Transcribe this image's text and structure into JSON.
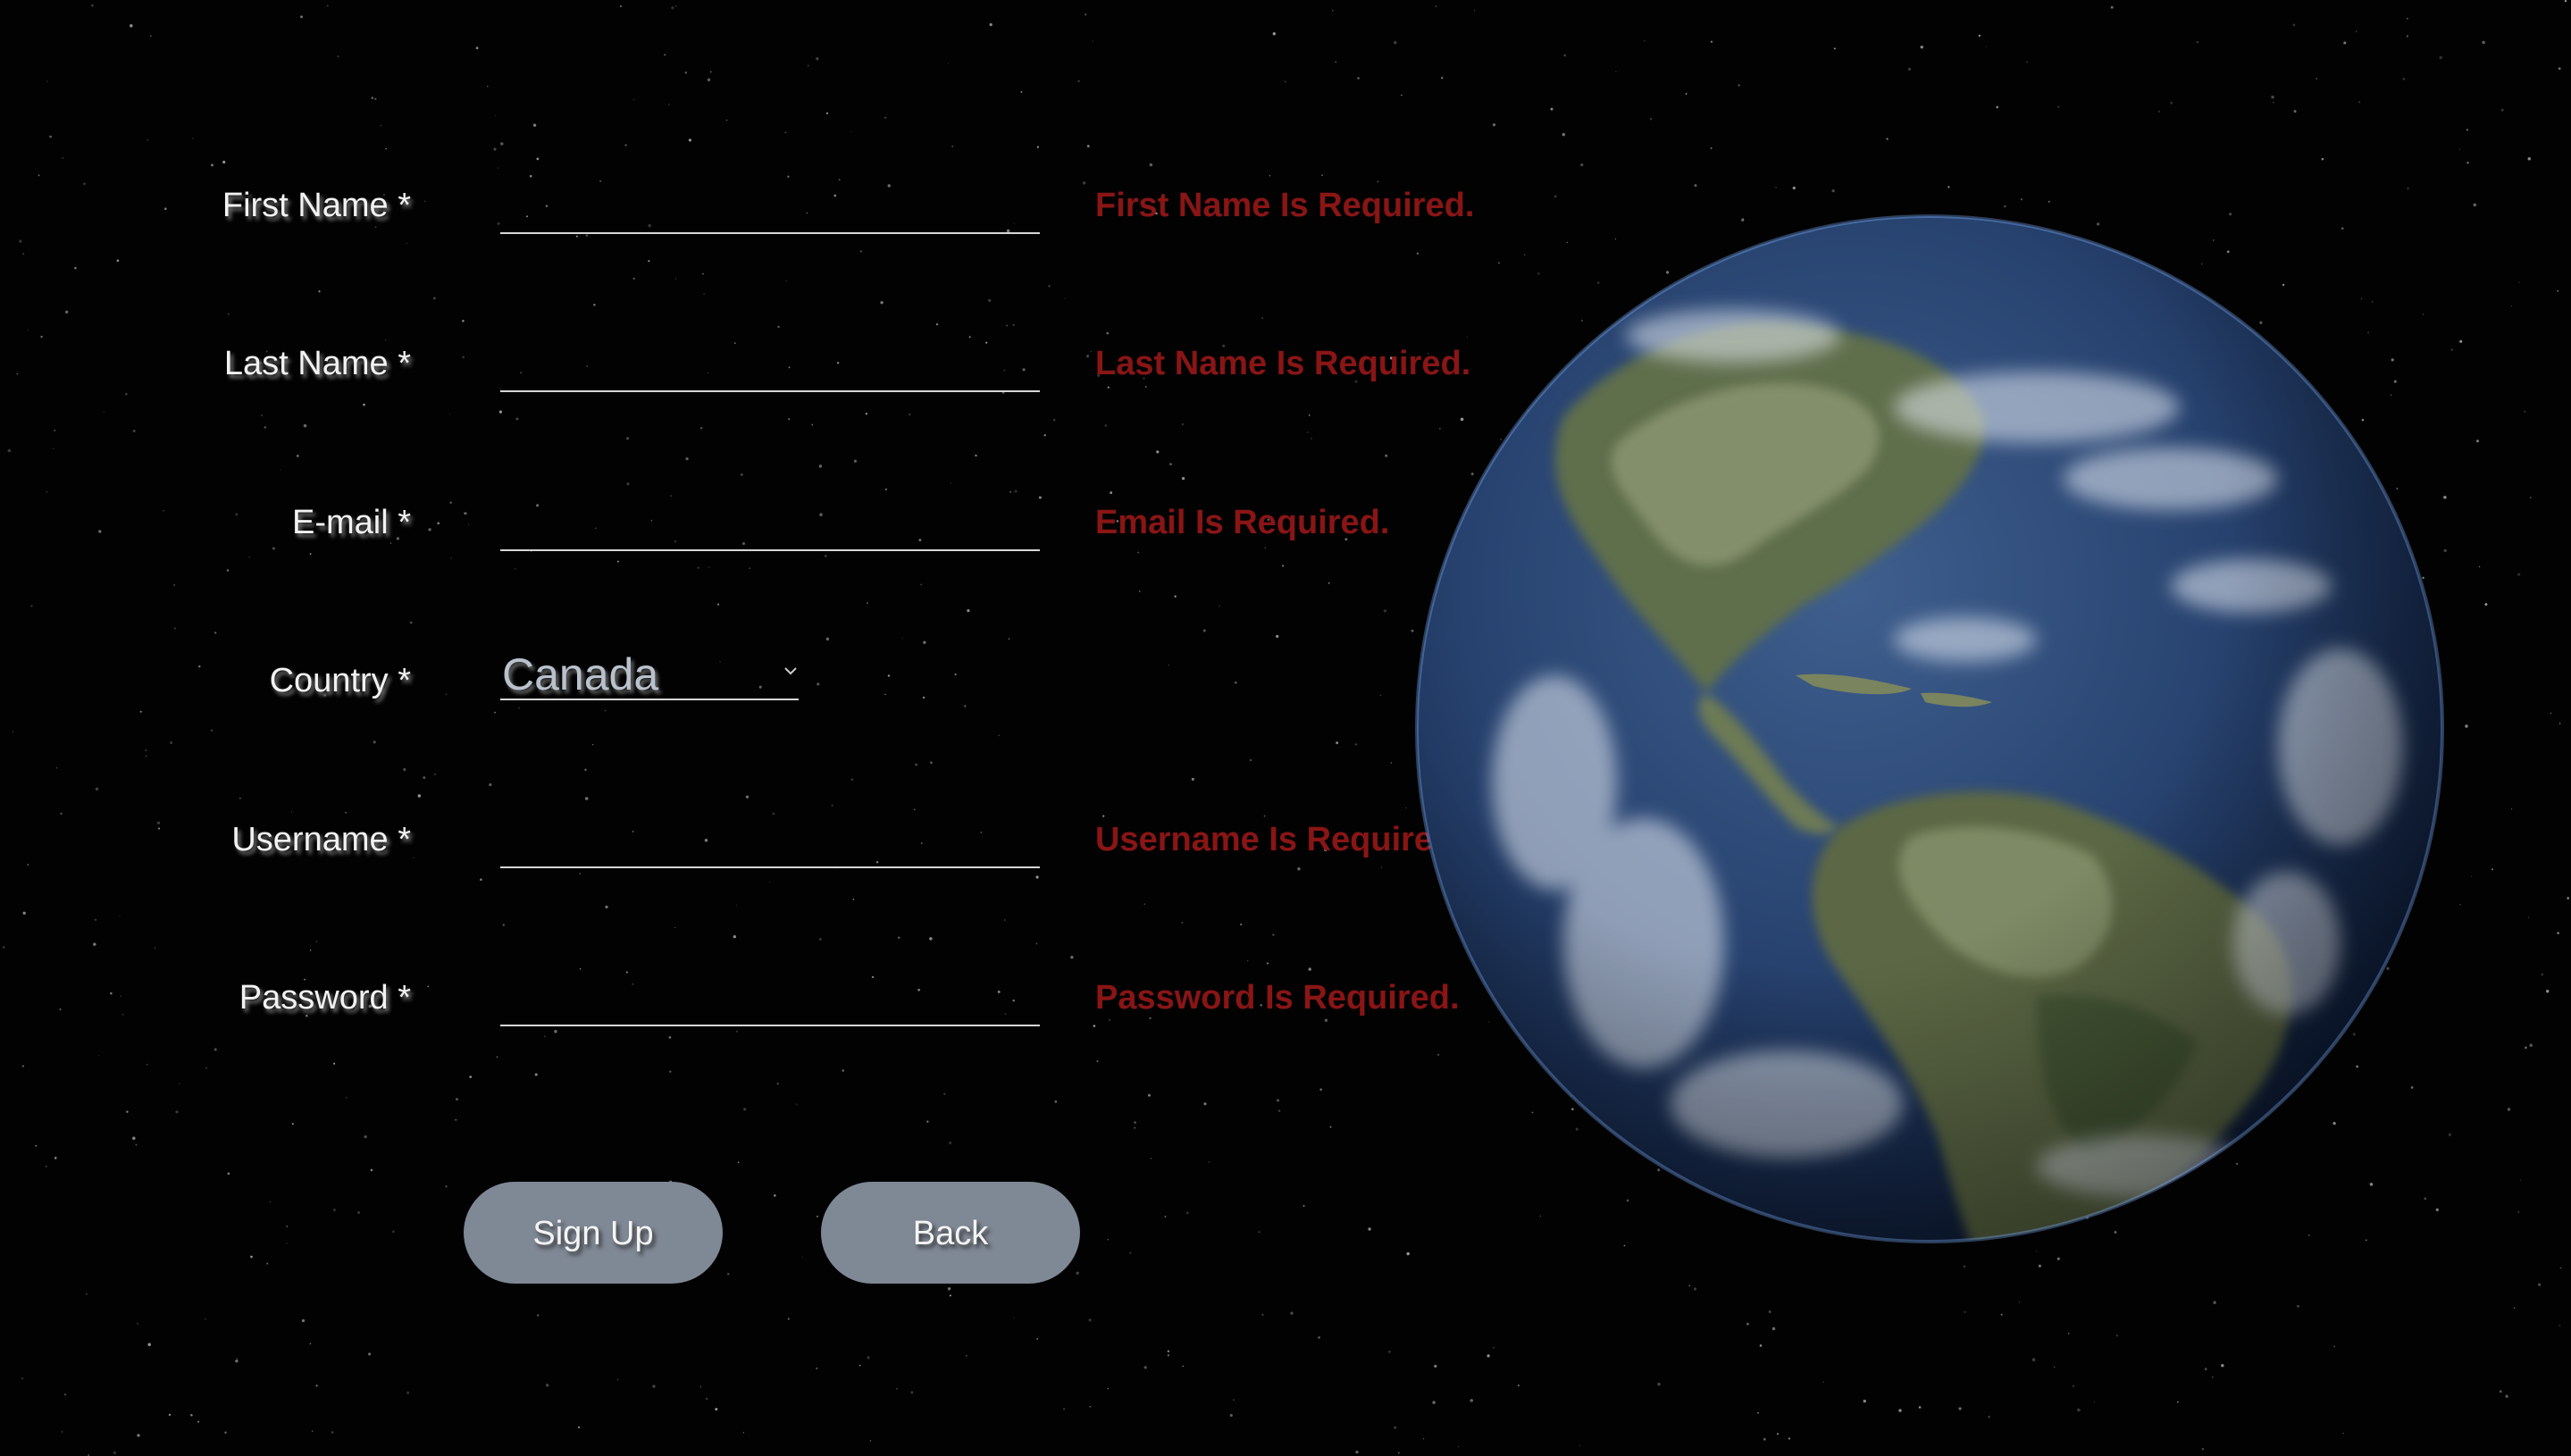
{
  "form": {
    "fields": [
      {
        "key": "first_name",
        "label": "First Name *",
        "value": "",
        "error": "First Name Is Required."
      },
      {
        "key": "last_name",
        "label": "Last Name *",
        "value": "",
        "error": "Last Name Is Required."
      },
      {
        "key": "email",
        "label": "E-mail *",
        "value": "",
        "error": "Email Is Required."
      },
      {
        "key": "country",
        "label": "Country *",
        "value": "Canada",
        "error": ""
      },
      {
        "key": "username",
        "label": "Username *",
        "value": "",
        "error": "Username Is Required."
      },
      {
        "key": "password",
        "label": "Password *",
        "value": "",
        "error": "Password Is Required."
      }
    ],
    "buttons": {
      "signup_label": "Sign Up",
      "back_label": "Back"
    }
  },
  "colors": {
    "background": "#020203",
    "error": "#8a1515",
    "button": "#7f8895",
    "label": "#f2f2f2"
  },
  "icons": {
    "select": "chevron-down-icon",
    "illustration": "earth-globe"
  }
}
